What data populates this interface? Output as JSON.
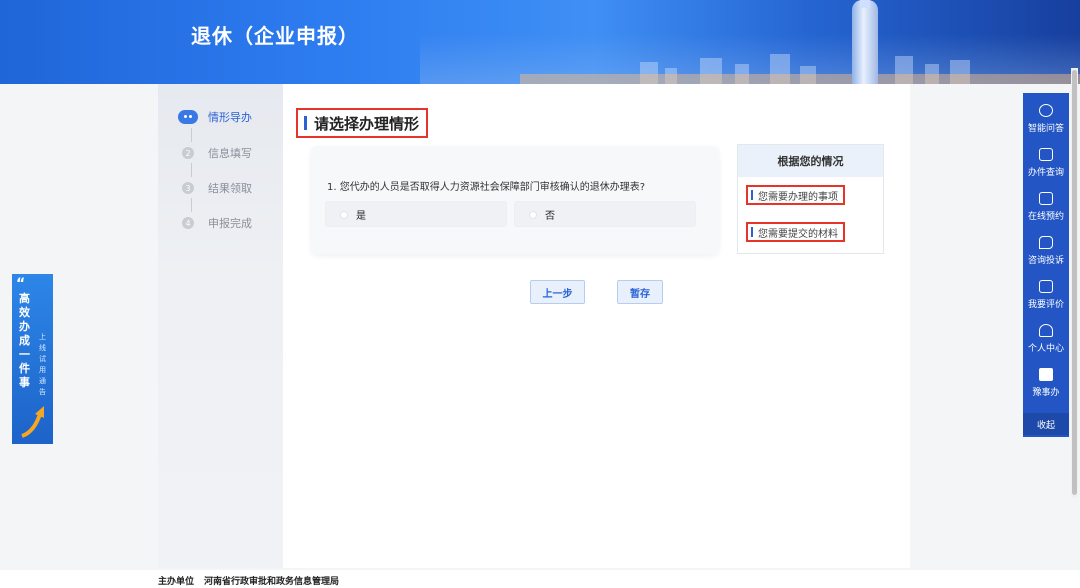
{
  "header": {
    "title": "退休（企业申报）"
  },
  "steps": [
    {
      "num": "",
      "label": "情形导办",
      "active": true
    },
    {
      "num": "2",
      "label": "信息填写"
    },
    {
      "num": "3",
      "label": "结果领取"
    },
    {
      "num": "4",
      "label": "申报完成"
    }
  ],
  "main": {
    "section_title": "请选择办理情形",
    "question": "1. 您代办的人员是否取得人力资源社会保障部门审核确认的退休办理表?",
    "options": [
      "是",
      "否"
    ],
    "buttons": {
      "prev": "上一步",
      "save": "暂存"
    }
  },
  "info_panel": {
    "title": "根据您的情况",
    "items": [
      "您需要办理的事项",
      "您需要提交的材料"
    ]
  },
  "side_tools": [
    {
      "label": "智能问答",
      "icon": "chat-bot-icon"
    },
    {
      "label": "办件查询",
      "icon": "search-doc-icon"
    },
    {
      "label": "在线预约",
      "icon": "calendar-icon"
    },
    {
      "label": "咨询投诉",
      "icon": "message-icon"
    },
    {
      "label": "我要评价",
      "icon": "edit-icon"
    },
    {
      "label": "个人中心",
      "icon": "user-icon"
    },
    {
      "label": "豫事办",
      "icon": "app-logo-icon"
    }
  ],
  "side_collapse": "收起",
  "promo": {
    "main_text": "高效办成一件事",
    "sub_text": "上线试用通告"
  },
  "footer": {
    "label": "主办单位",
    "org": "河南省行政审批和政务信息管理局"
  },
  "colors": {
    "primary": "#2a62d6",
    "highlight_border": "#e5352a",
    "side_bar": "#2356c4"
  }
}
